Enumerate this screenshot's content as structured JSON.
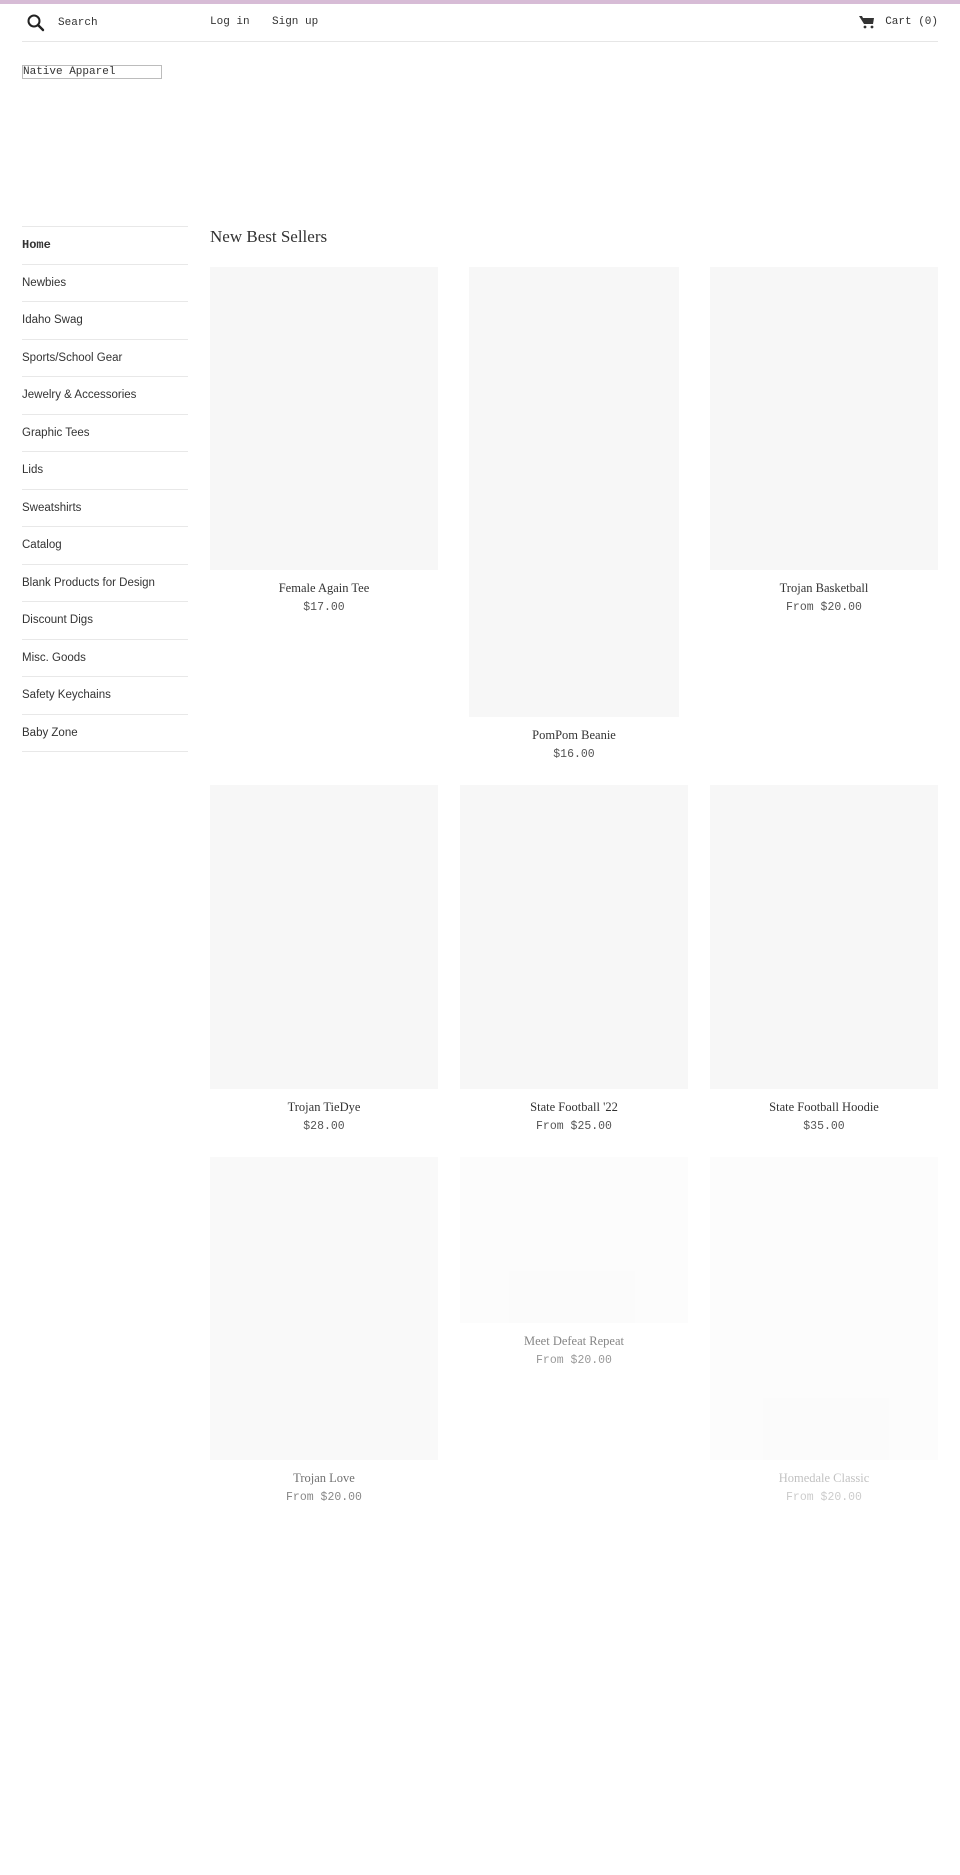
{
  "header": {
    "search_placeholder": "Search",
    "login_label": "Log in",
    "signup_label": "Sign up",
    "cart_label": "Cart (0)",
    "icons": {
      "search": "search-icon",
      "cart": "cart-icon"
    },
    "accent_color": "#d7bcd6"
  },
  "logo": {
    "text": "Native Apparel"
  },
  "sidebar": {
    "items": [
      {
        "label": "Home",
        "active": true
      },
      {
        "label": "Newbies"
      },
      {
        "label": "Idaho Swag"
      },
      {
        "label": "Sports/School Gear"
      },
      {
        "label": "Jewelry & Accessories"
      },
      {
        "label": "Graphic Tees"
      },
      {
        "label": "Lids"
      },
      {
        "label": "Sweatshirts"
      },
      {
        "label": "Catalog"
      },
      {
        "label": "Blank Products for Design"
      },
      {
        "label": "Discount Digs"
      },
      {
        "label": "Misc. Goods"
      },
      {
        "label": "Safety Keychains"
      },
      {
        "label": "Baby Zone"
      }
    ]
  },
  "main": {
    "section_title": "New Best Sellers",
    "products": [
      {
        "title": "Female Again Tee",
        "price": "$17.00"
      },
      {
        "title": "PomPom Beanie",
        "price": "$16.00"
      },
      {
        "title": "Trojan Basketball",
        "price": "From $20.00"
      },
      {
        "title": "Trojan TieDye",
        "price": "$28.00"
      },
      {
        "title": "State Football '22",
        "price": "From $25.00"
      },
      {
        "title": "State Football Hoodie",
        "price": "$35.00"
      },
      {
        "title": "Trojan Love",
        "price": "From $20.00"
      },
      {
        "title": "Meet Defeat Repeat",
        "price": "From $20.00"
      },
      {
        "title": "Homedale Classic",
        "price": "From $20.00"
      }
    ]
  }
}
